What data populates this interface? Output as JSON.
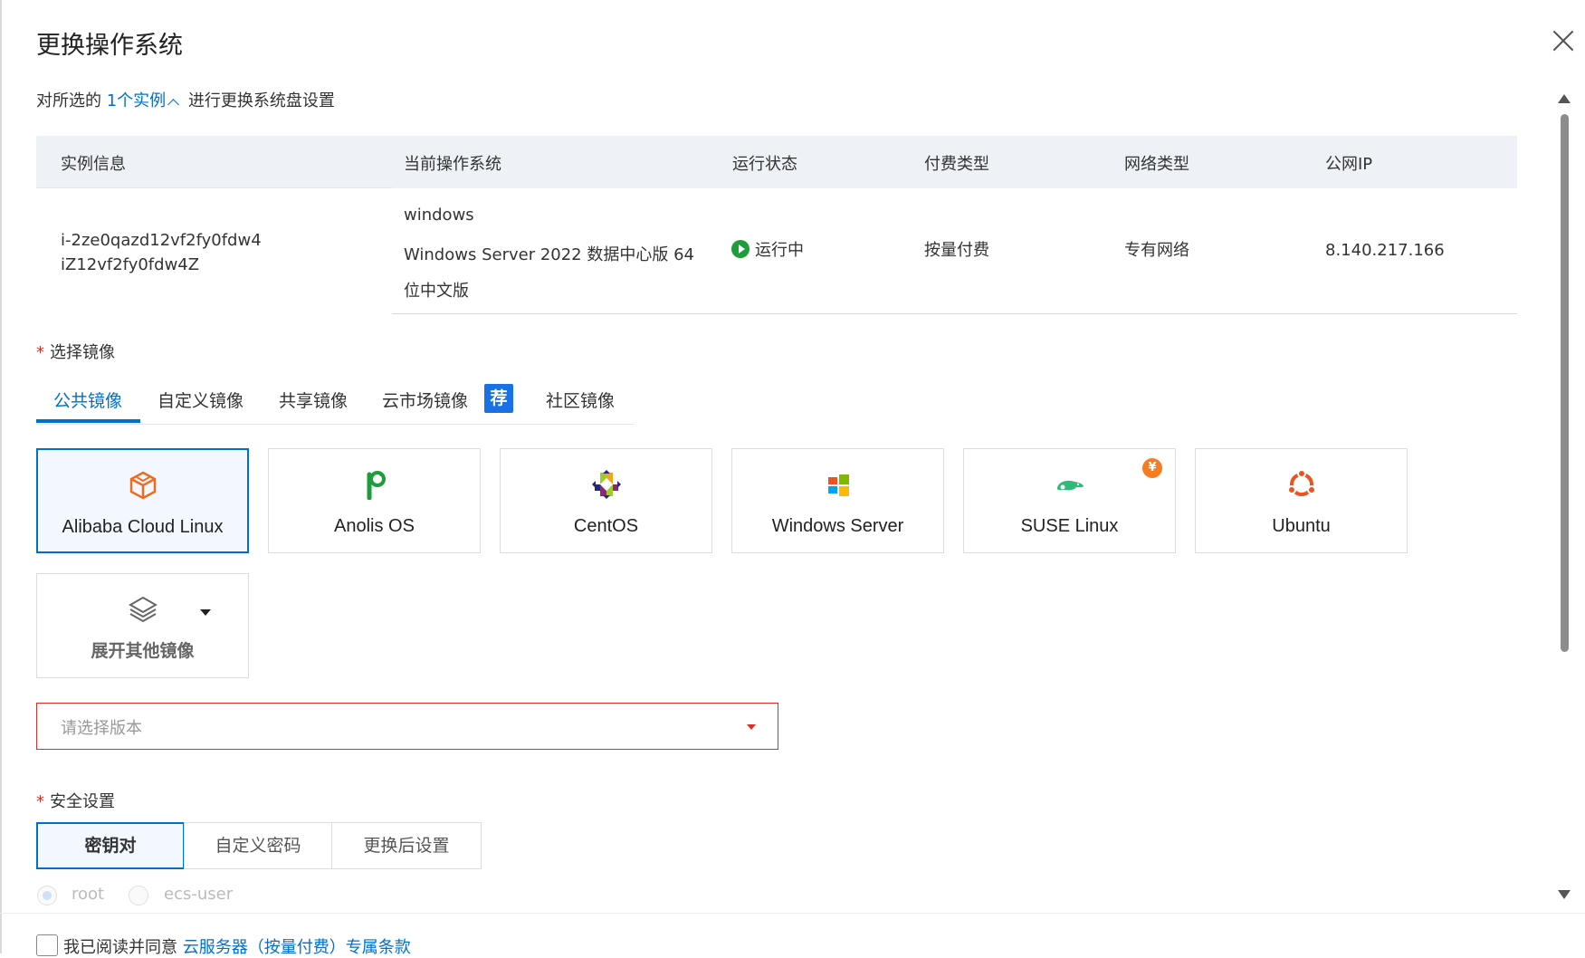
{
  "dialog": {
    "title": "更换操作系统",
    "subtitle_prefix": "对所选的",
    "subtitle_link": "1个实例",
    "subtitle_suffix": "进行更换系统盘设置"
  },
  "table": {
    "headers": [
      "实例信息",
      "当前操作系统",
      "运行状态",
      "付费类型",
      "网络类型",
      "公网IP"
    ],
    "row": {
      "instance_id": "i-2ze0qazd12vf2fy0fdw4",
      "instance_name": "iZ12vf2fy0fdw4Z",
      "os_family": "windows",
      "os_name": "Windows Server 2022 数据中心版 64位中文版",
      "status": "运行中",
      "billing": "按量付费",
      "network": "专有网络",
      "public_ip": "8.140.217.166"
    }
  },
  "image_section": {
    "label": "选择镜像",
    "required_mark": "*",
    "tabs": [
      "公共镜像",
      "自定义镜像",
      "共享镜像",
      "云市场镜像",
      "社区镜像"
    ],
    "active_tab": 0,
    "recommend_badge": "荐",
    "cards": [
      {
        "name": "Alibaba Cloud Linux",
        "icon": "alibaba-cloud-linux-icon",
        "selected": true
      },
      {
        "name": "Anolis OS",
        "icon": "anolis-icon"
      },
      {
        "name": "CentOS",
        "icon": "centos-icon"
      },
      {
        "name": "Windows Server",
        "icon": "windows-icon"
      },
      {
        "name": "SUSE Linux",
        "icon": "suse-icon",
        "paid_badge": "¥"
      },
      {
        "name": "Ubuntu",
        "icon": "ubuntu-icon"
      }
    ],
    "more_label": "展开其他镜像",
    "version_placeholder": "请选择版本"
  },
  "security_section": {
    "label": "安全设置",
    "required_mark": "*",
    "options": [
      "密钥对",
      "自定义密码",
      "更换后设置"
    ],
    "active_option": 0,
    "login_users": [
      "root",
      "ecs-user"
    ]
  },
  "footer": {
    "agree_text": "我已阅读并同意",
    "agree_link": "云服务器（按量付费）专属条款"
  },
  "colors": {
    "accent": "#0070cc",
    "error": "#d93026",
    "running": "#1e9e3a"
  }
}
